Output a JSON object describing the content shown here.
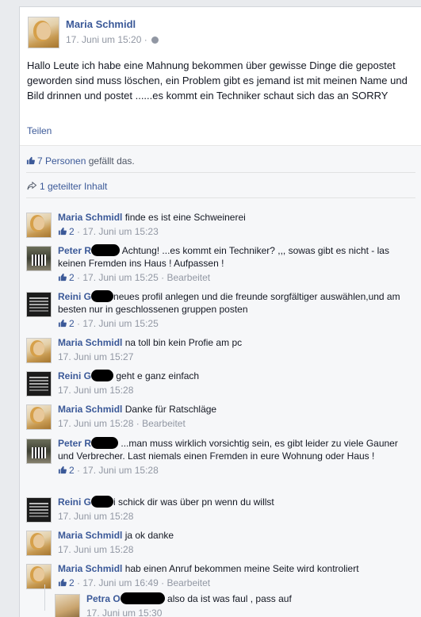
{
  "post": {
    "author": "Maria Schmidl",
    "time": "17. Juni um 15:20",
    "time_sep": " · ",
    "text": "Hallo Leute ich habe eine Mahnung bekommen über gewisse Dinge die gepostet geworden sind muss löschen, ein Problem gibt es jemand ist mit meinen Name und Bild drinnen und postet ......es kommt ein Techniker schaut sich das an SORRY",
    "share_label": "Teilen",
    "icons": {
      "privacy": "globe-icon"
    }
  },
  "ufi": {
    "likes_count_text": "7 Personen",
    "likes_suffix": " gefällt das.",
    "shares_text": "1 geteilter Inhalt",
    "icons": {
      "like": "thumbs-up-icon",
      "share": "share-arrow-icon"
    }
  },
  "comments": [
    {
      "author": "Maria Schmidl",
      "text": "finde es ist eine Schweinerei",
      "likes": "2",
      "time": "17. Juni um 15:23",
      "edited": ""
    },
    {
      "author": "Peter R",
      "text": "Achtung! ...es kommt ein Techniker? ,,, sowas gibt es nicht - las keinen Fremden ins Haus ! Aufpassen !",
      "likes": "2",
      "time": "17. Juni um 15:25",
      "edited": "Bearbeitet"
    },
    {
      "author": "Reini G",
      "text": "neues profil anlegen und die freunde sorgfältiger auswählen,und am besten nur in geschlossenen gruppen posten",
      "likes": "2",
      "time": "17. Juni um 15:25",
      "edited": ""
    },
    {
      "author": "Maria Schmidl",
      "text": "na toll bin kein Profie am pc",
      "likes": "",
      "time": "17. Juni um 15:27",
      "edited": ""
    },
    {
      "author": "Reini G",
      "text": "geht e ganz einfach",
      "likes": "",
      "time": "17. Juni um 15:28",
      "edited": ""
    },
    {
      "author": "Maria Schmidl",
      "text": "Danke für Ratschläge",
      "likes": "",
      "time": "17. Juni um 15:28",
      "edited": "Bearbeitet"
    },
    {
      "author": "Peter R",
      "text": "...man muss wirklich vorsichtig sein, es gibt leider zu viele Gauner und Verbrecher. Last niemals einen Fremden in eure Wohnung oder Haus !",
      "likes": "2",
      "time": "17. Juni um 15:28",
      "edited": ""
    },
    {
      "author": "Reini G",
      "text": "i schick dir was über pn wenn du willst",
      "likes": "",
      "time": "17. Juni um 15:28",
      "edited": ""
    },
    {
      "author": "Maria Schmidl",
      "text": "ja ok danke",
      "likes": "",
      "time": "17. Juni um 15:28",
      "edited": ""
    },
    {
      "author": "Maria Schmidl",
      "text": "hab einen Anruf bekommen meine Seite wird kontroliert",
      "likes": "2",
      "time": "17. Juni um 16:49",
      "edited": "Bearbeitet"
    }
  ],
  "reply": {
    "author": "Petra O",
    "text": "also da ist was faul , pass auf",
    "time": "17. Juni um 15:30"
  }
}
